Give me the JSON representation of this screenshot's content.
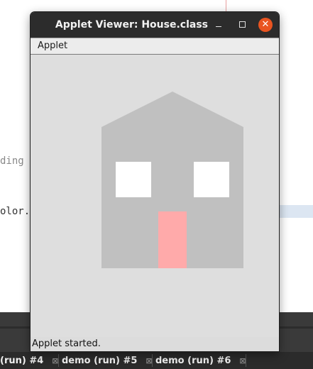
{
  "editor": {
    "fragment_1": "ding",
    "fragment_2": "olor."
  },
  "applet_window": {
    "title": "Applet Viewer: House.class",
    "controls": {
      "minimize": "minimize-icon",
      "maximize": "maximize-icon",
      "close": "close-icon",
      "close_glyph": "✕"
    },
    "menu": {
      "items": [
        {
          "label": "Applet"
        }
      ]
    },
    "status": "Applet started."
  },
  "house": {
    "body_color": "#c0c0c0",
    "window_color": "#ffffff",
    "door_color": "#ffaaaa"
  },
  "ide_tabs": [
    {
      "label": "(run) #4",
      "close_glyph": "⊠"
    },
    {
      "label": "demo (run) #5",
      "close_glyph": "⊠"
    },
    {
      "label": "demo (run) #6",
      "close_glyph": "⊠"
    }
  ],
  "colors": {
    "titlebar": "#2c2c2c",
    "close_button": "#e95420"
  }
}
